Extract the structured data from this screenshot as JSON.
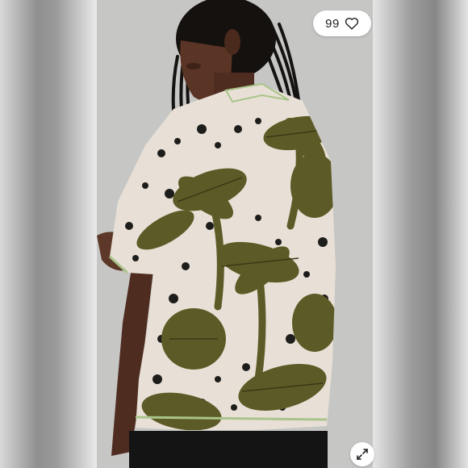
{
  "listing": {
    "likes": {
      "count": "99",
      "icon": "heart-outline-icon"
    },
    "expand": {
      "icon": "expand-arrows-icon"
    }
  },
  "colors": {
    "shirt_base": "#e8e0d6",
    "palm_olive": "#5c5a26",
    "spots": "#1d1d1b",
    "piping": "#a9c48a",
    "photo_backdrop": "#c6c6c4"
  }
}
